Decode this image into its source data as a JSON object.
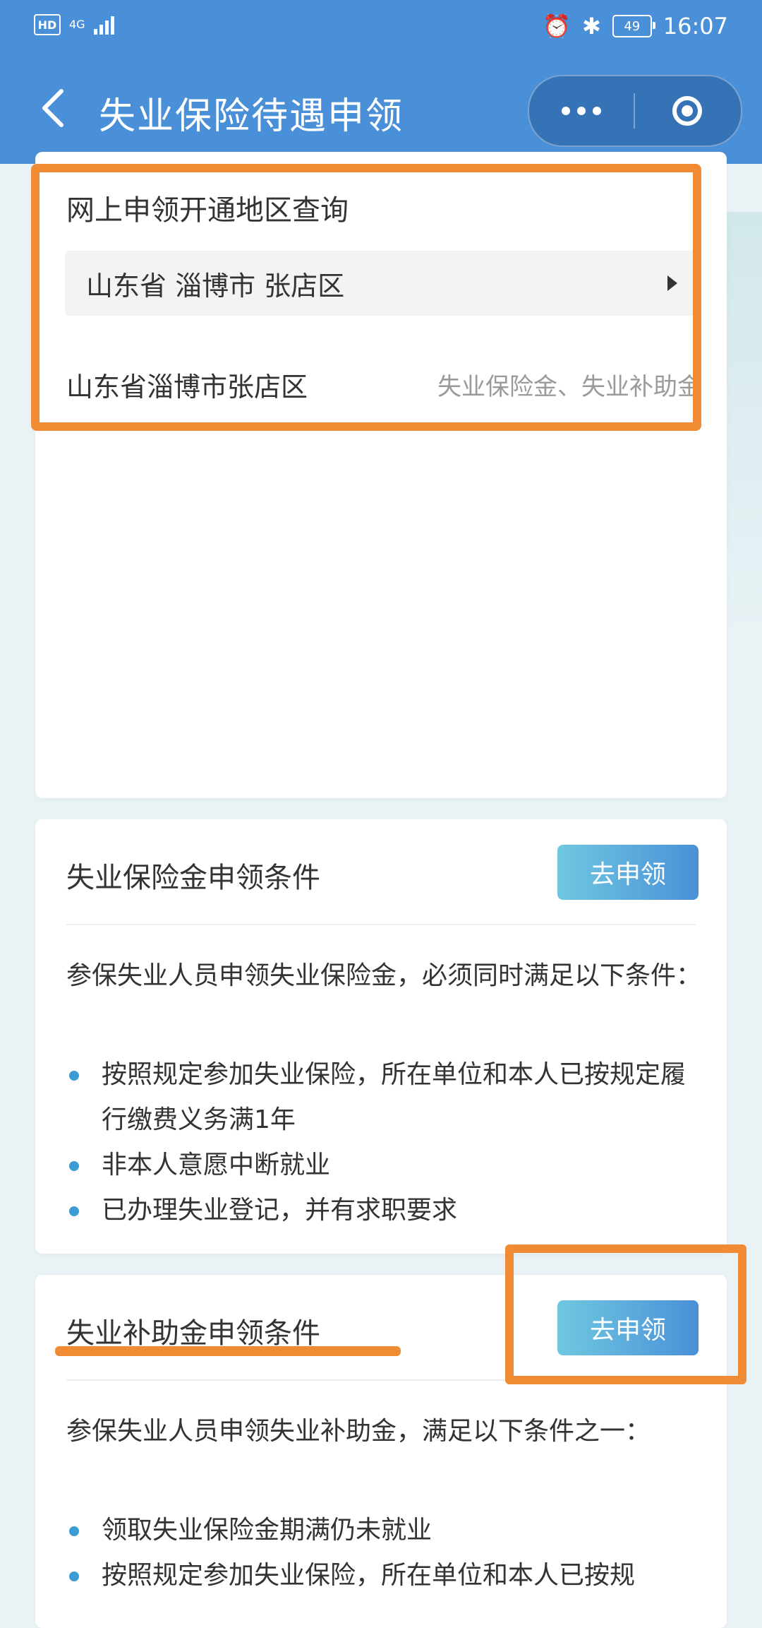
{
  "status_bar": {
    "hd": "HD",
    "network": "4G",
    "battery": "49",
    "time": "16:07"
  },
  "nav": {
    "title": "失业保险待遇申领"
  },
  "region_query": {
    "title": "网上申领开通地区查询",
    "selected_region": "山东省 淄博市 张店区",
    "result_region": "山东省淄博市张店区",
    "result_types": "失业保险金、失业补助金"
  },
  "unemployment_insurance": {
    "title": "失业保险金申领条件",
    "apply_label": "去申领",
    "intro": "参保失业人员申领失业保险金，必须同时满足以下条件：",
    "conditions": [
      "按照规定参加失业保险，所在单位和本人已按规定履行缴费义务满1年",
      "非本人意愿中断就业",
      "已办理失业登记，并有求职要求"
    ]
  },
  "unemployment_subsidy": {
    "title": "失业补助金申领条件",
    "apply_label": "去申领",
    "intro": "参保失业人员申领失业补助金，满足以下条件之一：",
    "conditions": [
      "领取失业保险金期满仍未就业",
      "按照规定参加失业保险，所在单位和本人已按规"
    ]
  },
  "colors": {
    "header_bg": "#4a90d9",
    "annotation": "#f08a33",
    "bullet": "#3a9bd5"
  }
}
